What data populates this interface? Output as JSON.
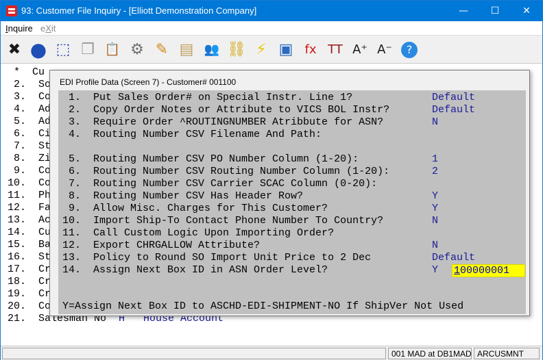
{
  "window": {
    "title": "93: Customer File Inquiry - [Elliott Demonstration Company]",
    "minimize": "—",
    "maximize": "☐",
    "close": "✕"
  },
  "menu": {
    "inquire": "Inquire",
    "exit": "eXit"
  },
  "toolbar": [
    {
      "name": "close-x-icon",
      "glyph": "✖",
      "color": "#1a1a1a"
    },
    {
      "name": "globe-icon",
      "glyph": "●",
      "color": "#1f4fb5"
    },
    {
      "name": "select-box-icon",
      "glyph": "⬚",
      "color": "#1f3fb5"
    },
    {
      "name": "copy-icon",
      "glyph": "❐",
      "color": "#9a9a9a"
    },
    {
      "name": "paste-icon",
      "glyph": "📋",
      "color": "#b08a2a"
    },
    {
      "name": "settings-gear-icon",
      "glyph": "⚙",
      "color": "#707070"
    },
    {
      "name": "edit-pencil-icon",
      "glyph": "✎",
      "color": "#d08a1a"
    },
    {
      "name": "notepad-icon",
      "glyph": "▤",
      "color": "#c0a060"
    },
    {
      "name": "users-icon",
      "glyph": "👥",
      "color": "#d02020"
    },
    {
      "name": "link-chain-icon",
      "glyph": "⛓",
      "color": "#d0a000"
    },
    {
      "name": "lightning-icon",
      "glyph": "⚡",
      "color": "#e8c800"
    },
    {
      "name": "screen-edit-icon",
      "glyph": "▣",
      "color": "#2a6ac0"
    },
    {
      "name": "function-fx-icon",
      "glyph": "fx",
      "color": "#d01818"
    },
    {
      "name": "font-size-icon",
      "glyph": "TT",
      "color": "#9a1a1a"
    },
    {
      "name": "font-increase-icon",
      "glyph": "A⁺",
      "color": "#1a1a1a"
    },
    {
      "name": "font-decrease-icon",
      "glyph": "A⁻",
      "color": "#1a1a1a"
    },
    {
      "name": "help-icon",
      "glyph": "?",
      "color": "#1a7ad0"
    }
  ],
  "background_screen": {
    "lines": [
      {
        "text": " *  Cu"
      },
      {
        "text": " 2.  So"
      },
      {
        "text": " 3.  Co"
      },
      {
        "text": " 4.  Ad"
      },
      {
        "text": " 5.  Ad"
      },
      {
        "text": " 6.  Ci"
      },
      {
        "text": " 7.  St"
      },
      {
        "text": " 8.  Zi"
      },
      {
        "text": " 9.  Co"
      },
      {
        "text": "10.  Co"
      },
      {
        "text": "11.  Ph"
      },
      {
        "text": "12.  Fa"
      },
      {
        "text": "13.  Ac"
      },
      {
        "text": "14.  Cu"
      },
      {
        "text": "15.  Ba"
      },
      {
        "text": "16.  St"
      },
      {
        "text": "17.  Cr"
      },
      {
        "text": "18.  Cr"
      },
      {
        "text": "19.  Cr"
      },
      {
        "text": "20.  Co"
      }
    ],
    "last_line": {
      "label": "21.  Salesman No",
      "code": "H",
      "value": "House Account"
    }
  },
  "dialog": {
    "title": "EDI Profile Data (Screen 7) - Customer# 001100",
    "rows": [
      {
        "label": " 1.  Put Sales Order# on Special Instr. Line 1?",
        "value": "Default"
      },
      {
        "label": " 2.  Copy Order Notes or Attribute to VICS BOL Instr?",
        "value": "Default"
      },
      {
        "label": " 3.  Require Order ^ROUTINGNUMBER Atribbute for ASN?",
        "value": "N"
      },
      {
        "label": " 4.  Routing Number CSV Filename And Path:",
        "value": ""
      },
      {
        "label": "",
        "value": ""
      },
      {
        "label": " 5.  Routing Number CSV PO Number Column (1-20):",
        "value": "1"
      },
      {
        "label": " 6.  Routing Number CSV Routing Number Column (1-20):",
        "value": "2"
      },
      {
        "label": " 7.  Routing Number CSV Carrier SCAC Column (0-20):",
        "value": ""
      },
      {
        "label": " 8.  Routing Number CSV Has Header Row?",
        "value": "Y"
      },
      {
        "label": " 9.  Allow Misc. Charges for This Customer?",
        "value": "Y"
      },
      {
        "label": "10.  Import Ship-To Contact Phone Number To Country?",
        "value": "N"
      },
      {
        "label": "11.  Call Custom Logic Upon Importing Order?",
        "value": ""
      },
      {
        "label": "12.  Export CHRGALLOW Attribute?",
        "value": "N"
      },
      {
        "label": "13.  Policy to Round SO Import Unit Price to 2 Dec",
        "value": "Default"
      },
      {
        "label": "14.  Assign Next Box ID in ASN Order Level?",
        "value": "Y"
      }
    ],
    "input": {
      "first_char": "1",
      "rest": "00000001"
    },
    "hint": "Y=Assign Next Box ID to ASCHD-EDI-SHIPMENT-NO If ShipVer Not Used"
  },
  "status": {
    "user": "001 MAD at DB1MAD",
    "program": "ARCUSMNT"
  }
}
